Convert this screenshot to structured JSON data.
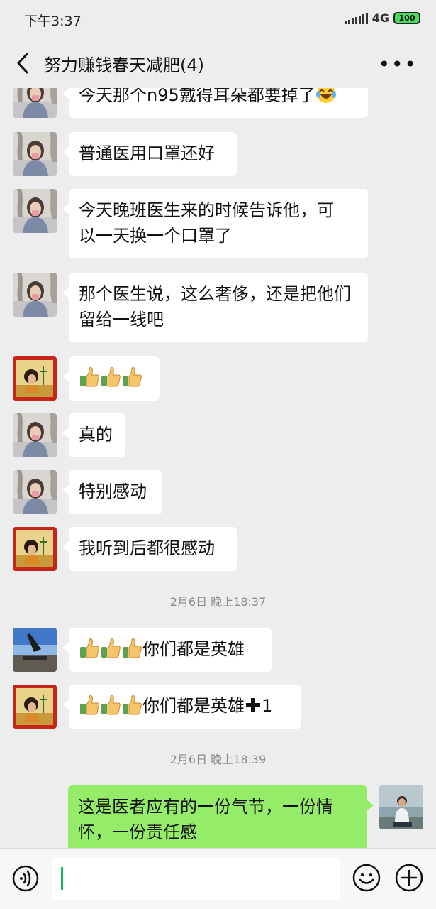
{
  "status_bar": {
    "time": "下午3:37",
    "network": "4G",
    "battery": "100"
  },
  "header": {
    "title": "努力赚钱春天减肥(4)"
  },
  "messages": [
    {
      "sender": "female-user",
      "text": "今天那个n95戴得耳朵都要掉了",
      "emoji": "laughing-tears"
    },
    {
      "sender": "female-user",
      "line1": "普通医用口罩还好"
    },
    {
      "sender": "female-user",
      "line1": "今天晚班医生来的时候告诉他，可",
      "line2": "以一天换一个口罩了"
    },
    {
      "sender": "female-user",
      "line1": "那个医生说，这么奢侈，还是把他们",
      "line2": "留给一线吧"
    },
    {
      "sender": "new-year-user",
      "thumbs": 3
    },
    {
      "sender": "female-user",
      "line1": "真的"
    },
    {
      "sender": "female-user",
      "line1": "特别感动"
    },
    {
      "sender": "new-year-user",
      "line1": "我听到后都很感动"
    },
    {
      "sender": "yoga-user",
      "thumbs": 3,
      "text": "你们都是英雄"
    },
    {
      "sender": "new-year-user",
      "thumbs": 3,
      "text": "你们都是英雄",
      "suffix": "1"
    },
    {
      "sender": "me",
      "line1": "这是医者应有的一份气节，一份情",
      "line2": "怀，一份责任感"
    }
  ],
  "timestamps": [
    "2月6日 晚上18:37",
    "2月6日 晚上18:39"
  ],
  "avatar_labels": {
    "new_year_tl": "鼠",
    "new_year_tr": "年",
    "new_year_bl": "大",
    "new_year_br": "吉"
  },
  "colors": {
    "background": "#ededed",
    "my_bubble": "#95ec69",
    "other_bubble": "#ffffff",
    "caret": "#07c160"
  }
}
